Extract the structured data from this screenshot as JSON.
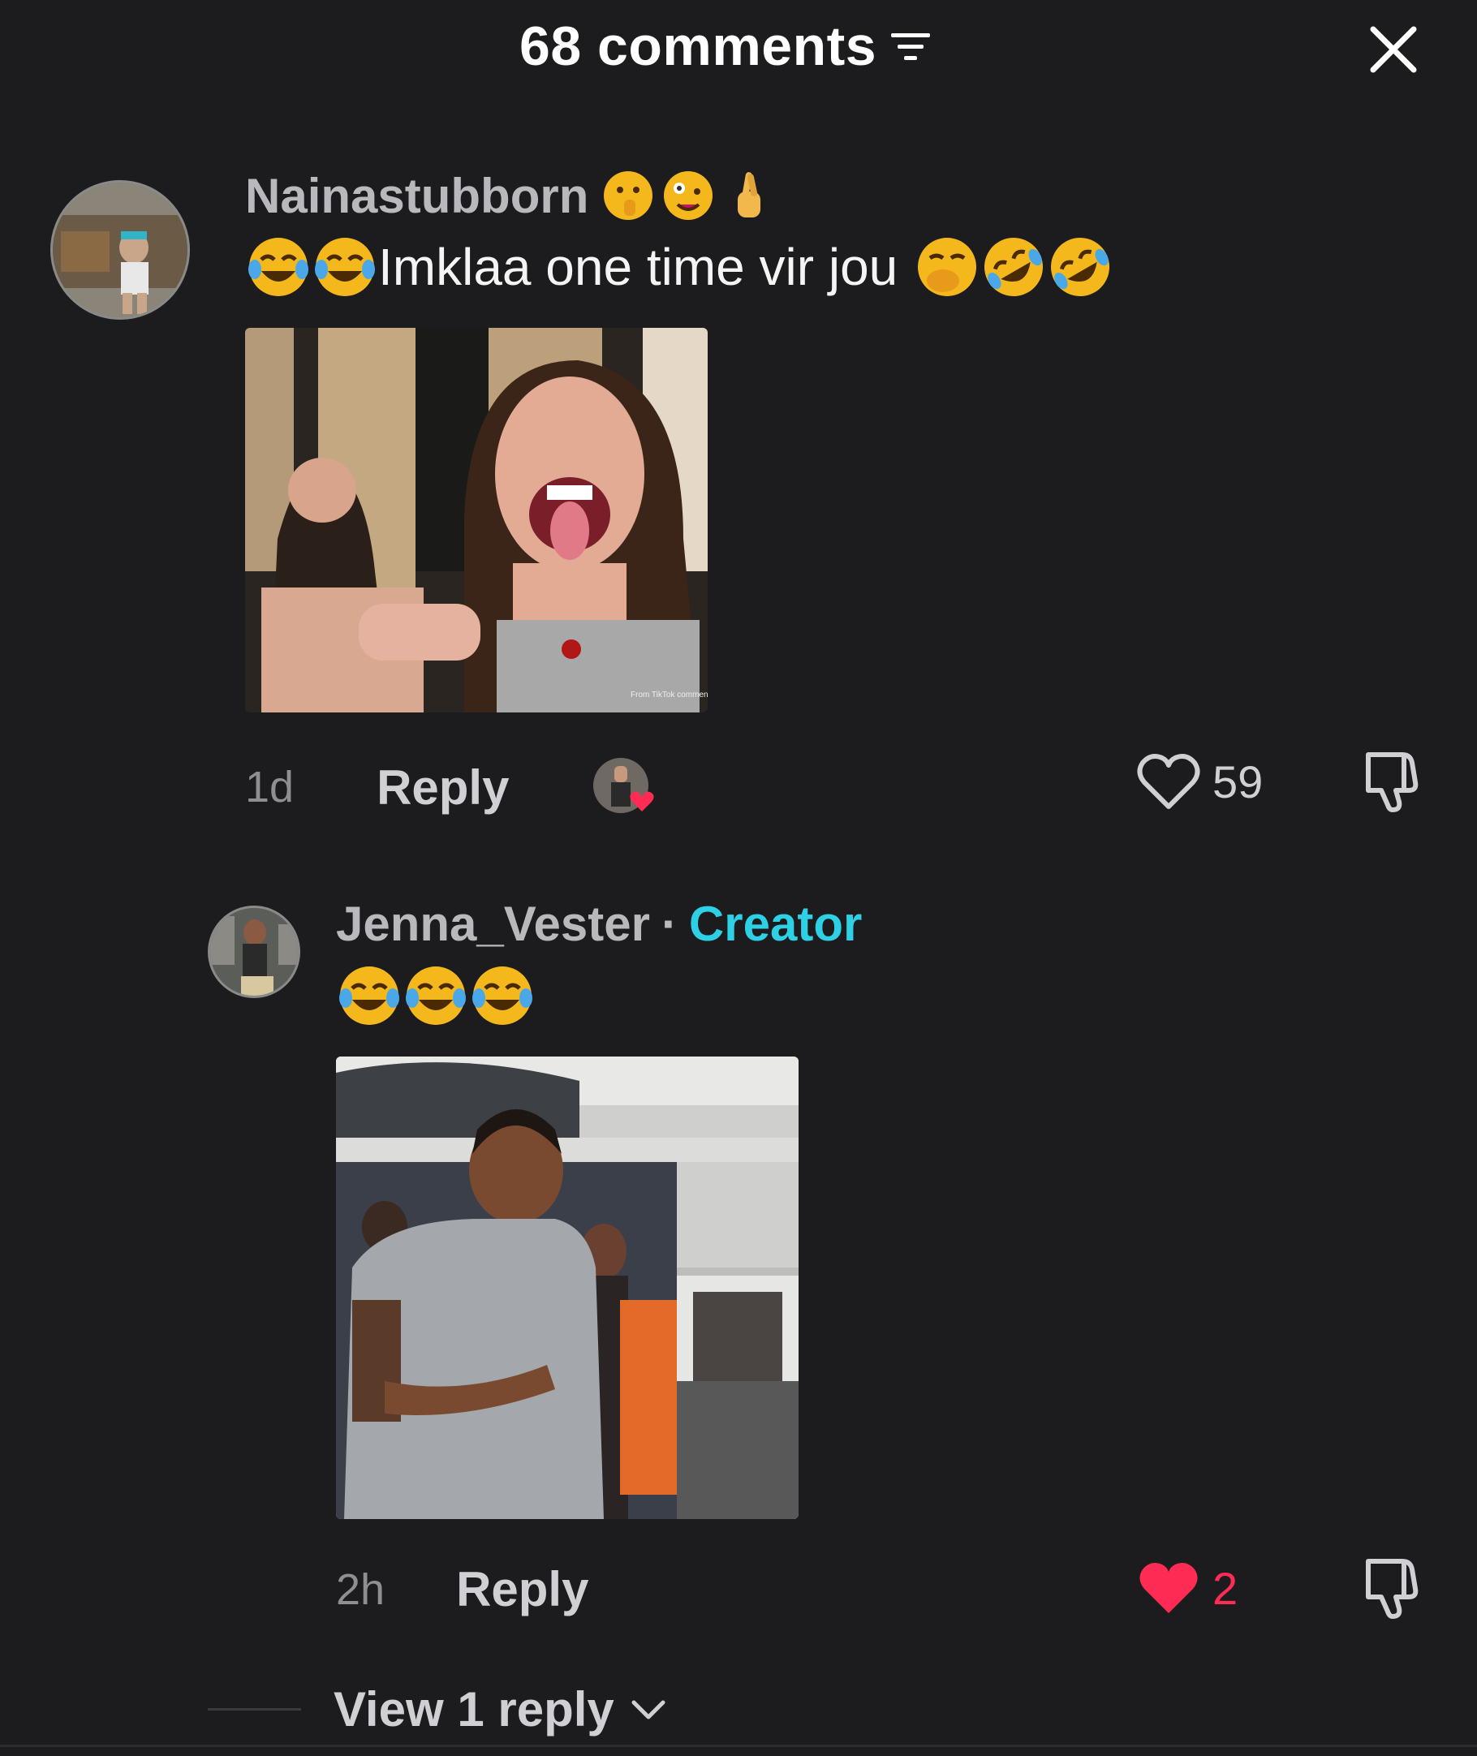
{
  "header": {
    "title": "68 comments",
    "filter_icon": "filter-lines-icon",
    "close_icon": "close-x-icon"
  },
  "comments": [
    {
      "username": "Nainastubborn",
      "username_emojis": [
        "shushing-face",
        "zany-face",
        "crossed-fingers"
      ],
      "text_prefix_emojis": [
        "tears-of-joy",
        "tears-of-joy"
      ],
      "text": "Imklaa one time vir jou",
      "text_suffix_emojis": [
        "hand-over-mouth",
        "rolling-on-floor-laughing",
        "rolling-on-floor-laughing"
      ],
      "media_alt": "two women laughing",
      "media_caption": "From TikTok comment",
      "time": "1d",
      "reply_label": "Reply",
      "liked_by_creator": true,
      "likes": "59",
      "liked": false
    },
    {
      "username": "Jenna_Vester",
      "separator": "·",
      "badge": "Creator",
      "text_emojis": [
        "tears-of-joy",
        "tears-of-joy",
        "tears-of-joy"
      ],
      "media_alt": "person dancing in grey top",
      "time": "2h",
      "reply_label": "Reply",
      "likes": "2",
      "liked": true
    }
  ],
  "view_replies": "View 1 reply",
  "colors": {
    "background": "#1c1c1e",
    "creator": "#2ed0e6",
    "like_active": "#fe2c55",
    "muted": "#8e8e93"
  }
}
